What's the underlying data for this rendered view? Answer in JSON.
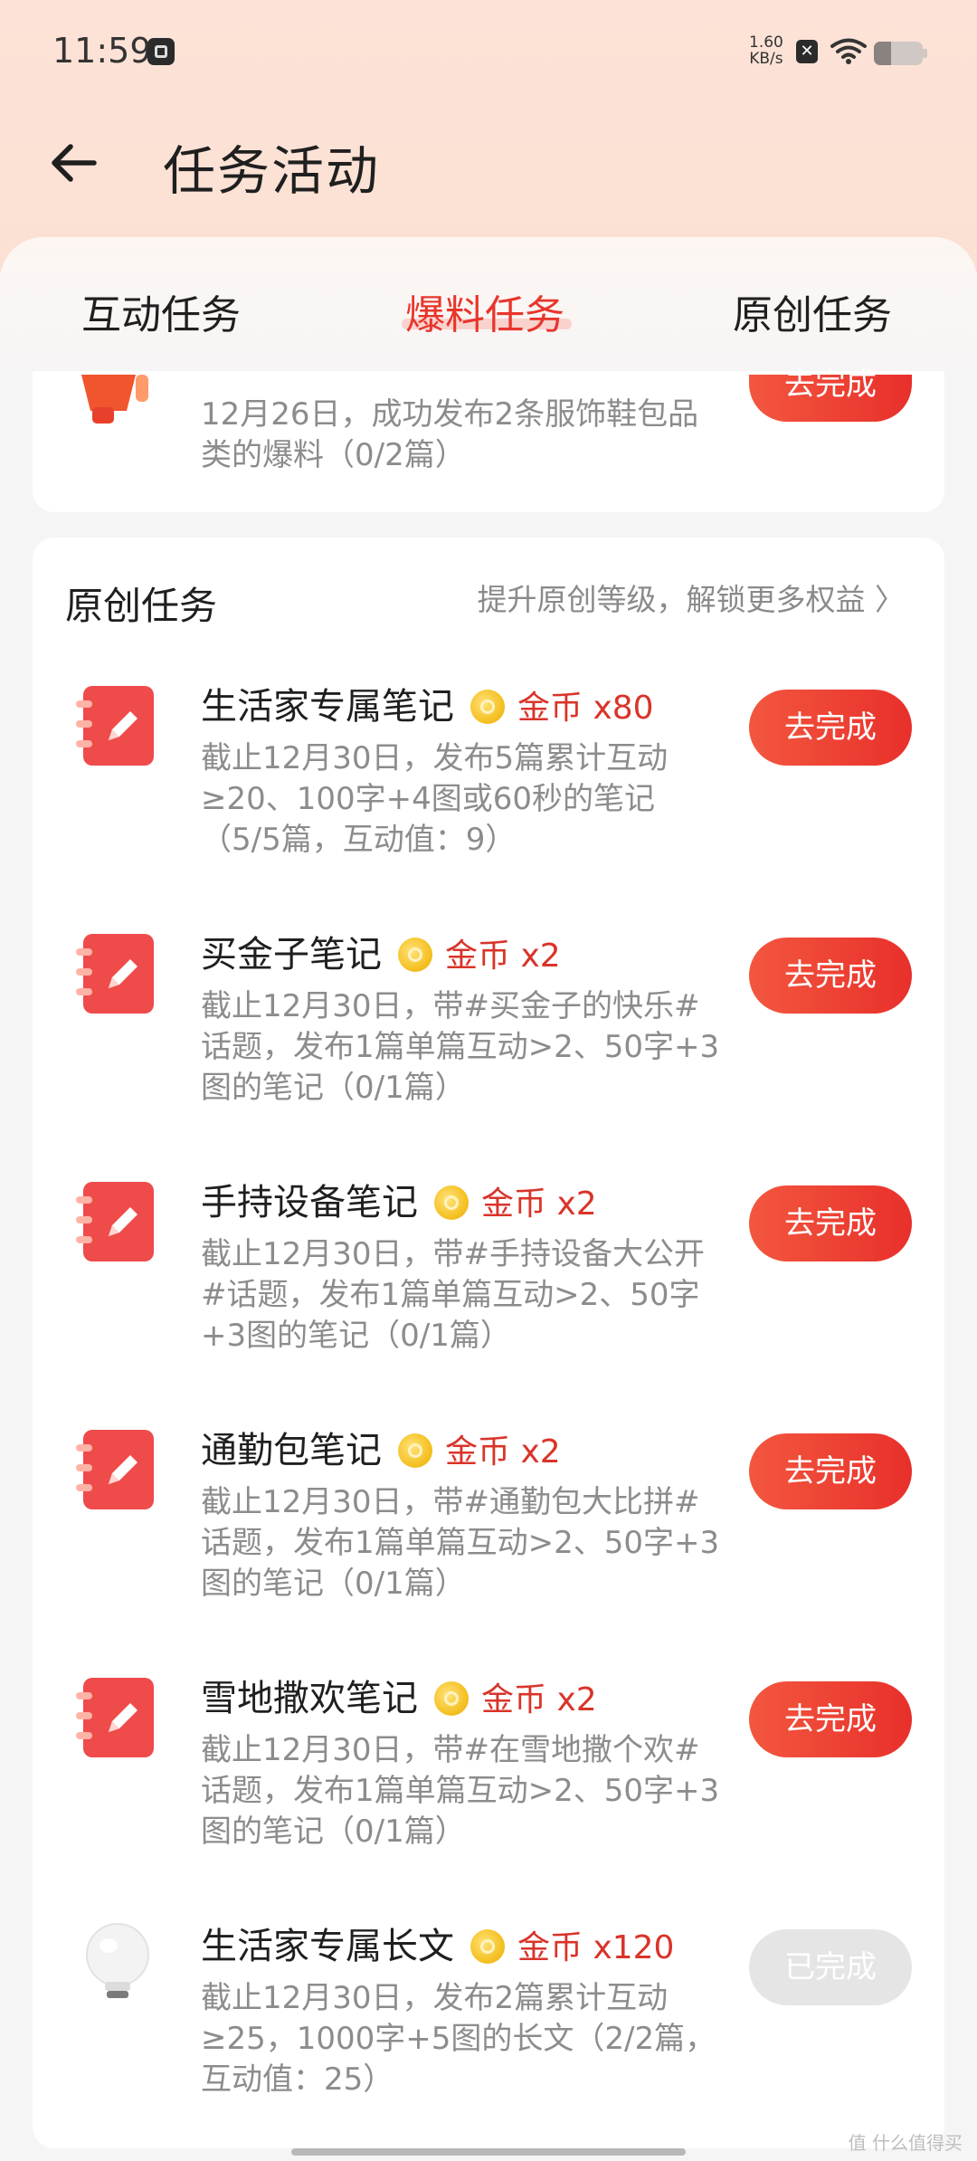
{
  "status_bar": {
    "time": "11:59",
    "net_speed_value": "1.60",
    "net_speed_unit": "KB/s",
    "battery_level": 0.35,
    "icons": [
      "app-notification-icon",
      "close-badge-icon",
      "wifi-icon",
      "battery-icon"
    ]
  },
  "header": {
    "title": "任务活动",
    "back_icon": "back-arrow-icon"
  },
  "tabs": [
    {
      "label": "互动任务",
      "active": false
    },
    {
      "label": "爆料任务",
      "active": true
    },
    {
      "label": "原创任务",
      "active": false
    }
  ],
  "partial_task": {
    "desc": "12月26日，成功发布2条服饰鞋包品类的爆料（0/2篇）",
    "button": "去完成",
    "icon": "megaphone-icon"
  },
  "section": {
    "title": "原创任务",
    "link": "提升原创等级，解锁更多权益 〉"
  },
  "tasks": [
    {
      "title": "生活家专属笔记",
      "reward": "金币 x80",
      "desc": "截止12月30日，发布5篇累计互动≥20、100字+4图或60秒的笔记（5/5篇，互动值：9）",
      "button": "去完成",
      "icon": "note-pencil-icon"
    },
    {
      "title": "买金子笔记",
      "reward": "金币 x2",
      "desc": "截止12月30日，带#买金子的快乐#话题，发布1篇单篇互动>2、50字+3图的笔记（0/1篇）",
      "button": "去完成",
      "icon": "note-pencil-icon"
    },
    {
      "title": "手持设备笔记",
      "reward": "金币 x2",
      "desc": "截止12月30日，带#手持设备大公开#话题，发布1篇单篇互动>2、50字+3图的笔记（0/1篇）",
      "button": "去完成",
      "icon": "note-pencil-icon"
    },
    {
      "title": "通勤包笔记",
      "reward": "金币 x2",
      "desc": "截止12月30日，带#通勤包大比拼#话题，发布1篇单篇互动>2、50字+3图的笔记（0/1篇）",
      "button": "去完成",
      "icon": "note-pencil-icon"
    },
    {
      "title": "雪地撒欢笔记",
      "reward": "金币 x2",
      "desc": "截止12月30日，带#在雪地撒个欢#话题，发布1篇单篇互动>2、50字+3图的笔记（0/1篇）",
      "button": "去完成",
      "icon": "note-pencil-icon"
    },
    {
      "title": "生活家专属长文",
      "reward": "金币 x120",
      "desc": "截止12月30日，发布2篇累计互动≥25，1000字+5图的长文（2/2篇，互动值：25）",
      "button": "已完成",
      "icon": "lightbulb-icon"
    }
  ],
  "watermark": "值 什么值得买",
  "colors": {
    "accent": "#e8352b",
    "button": "#ef4433",
    "header_bg": "#fde3d7"
  }
}
